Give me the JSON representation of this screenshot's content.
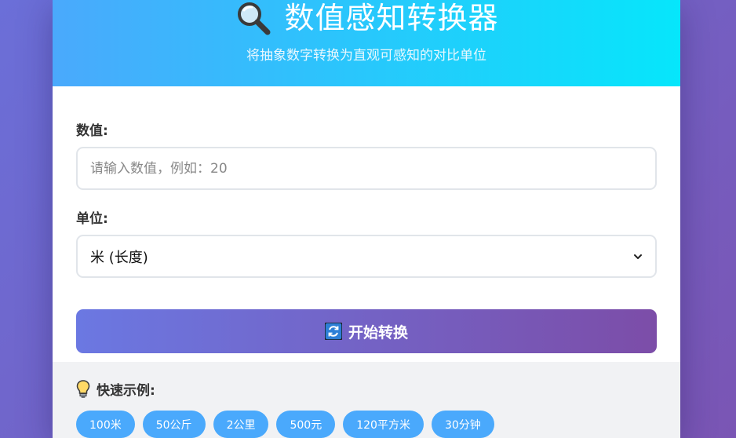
{
  "header": {
    "title": "数值感知转换器",
    "subtitle": "将抽象数字转换为直观可感知的对比单位",
    "title_icon": "magnifier-icon"
  },
  "form": {
    "value_label": "数值:",
    "value_placeholder": "请输入数值，例如：20",
    "unit_label": "单位:",
    "unit_selected": "米 (长度)",
    "convert_button": "开始转换",
    "convert_icon": "refresh-icon"
  },
  "examples": {
    "title": "快速示例:",
    "icon": "lightbulb-icon",
    "chips": [
      "100米",
      "50公斤",
      "2公里",
      "500元",
      "120平方米",
      "30分钟"
    ]
  },
  "colors": {
    "header_start": "#4aa9fc",
    "header_end": "#06e6fb",
    "button_start": "#6b78e2",
    "button_end": "#7c4da8",
    "chip": "#4aa9fc"
  }
}
